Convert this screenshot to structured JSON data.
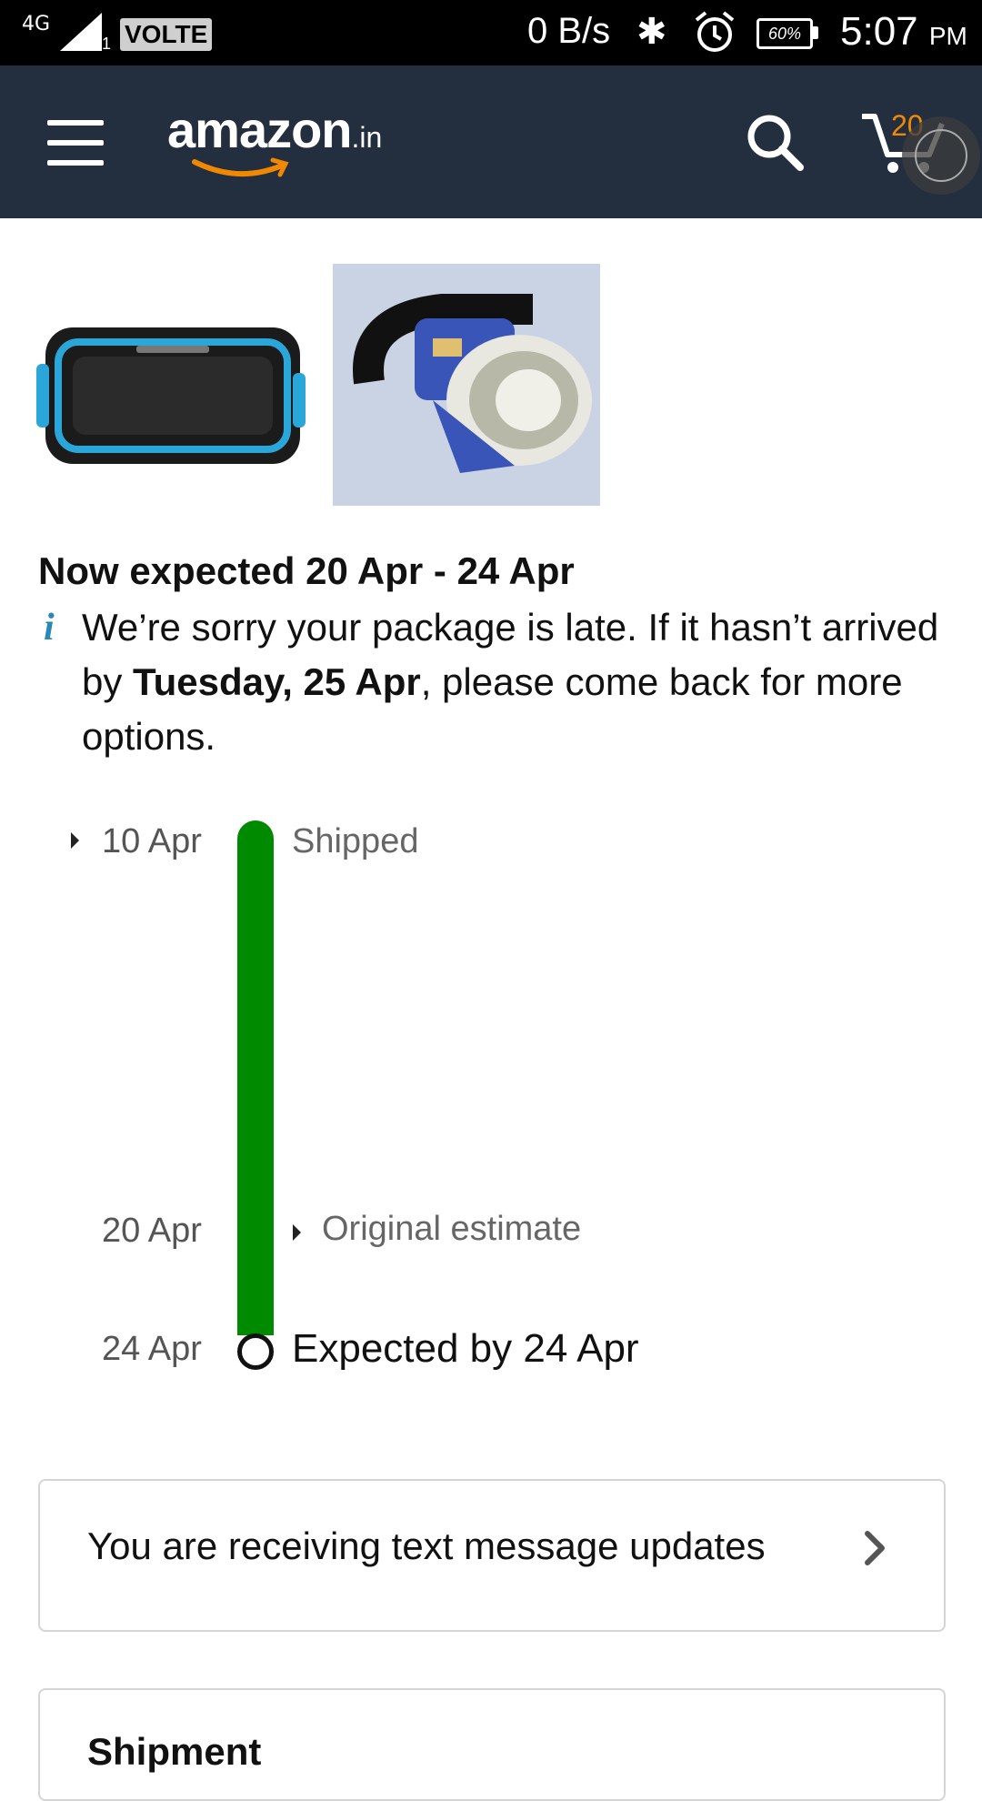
{
  "status_bar": {
    "network": "4G",
    "sim": "1",
    "volte": "VOLTE",
    "speed": "0 B/s",
    "battery": "60%",
    "time": "5:07",
    "ampm": "PM"
  },
  "header": {
    "logo_text": "amazon",
    "logo_tld": ".in",
    "cart_count": "20",
    "colors": {
      "background": "#232f3e",
      "accent": "#f08804"
    }
  },
  "products": [
    {
      "icon": "bluetooth-speaker-image"
    },
    {
      "icon": "head-torch-image"
    }
  ],
  "delivery": {
    "headline": "Now expected 20 Apr - 24 Apr",
    "late_message_pre": "We’re sorry your package is late. If it hasn’t arrived by ",
    "late_message_bold": "Tuesday, 25 Apr",
    "late_message_post": ", please come back for more options."
  },
  "timeline": {
    "shipped_date": "10 Apr",
    "shipped_label": "Shipped",
    "original_date": "20 Apr",
    "original_label": "Original estimate",
    "expected_date": "24 Apr",
    "expected_label": "Expected by 24 Apr",
    "bar_color": "#008a00"
  },
  "updates_card": {
    "text": "You are receiving text message updates"
  },
  "shipment_card": {
    "title": "Shipment"
  }
}
